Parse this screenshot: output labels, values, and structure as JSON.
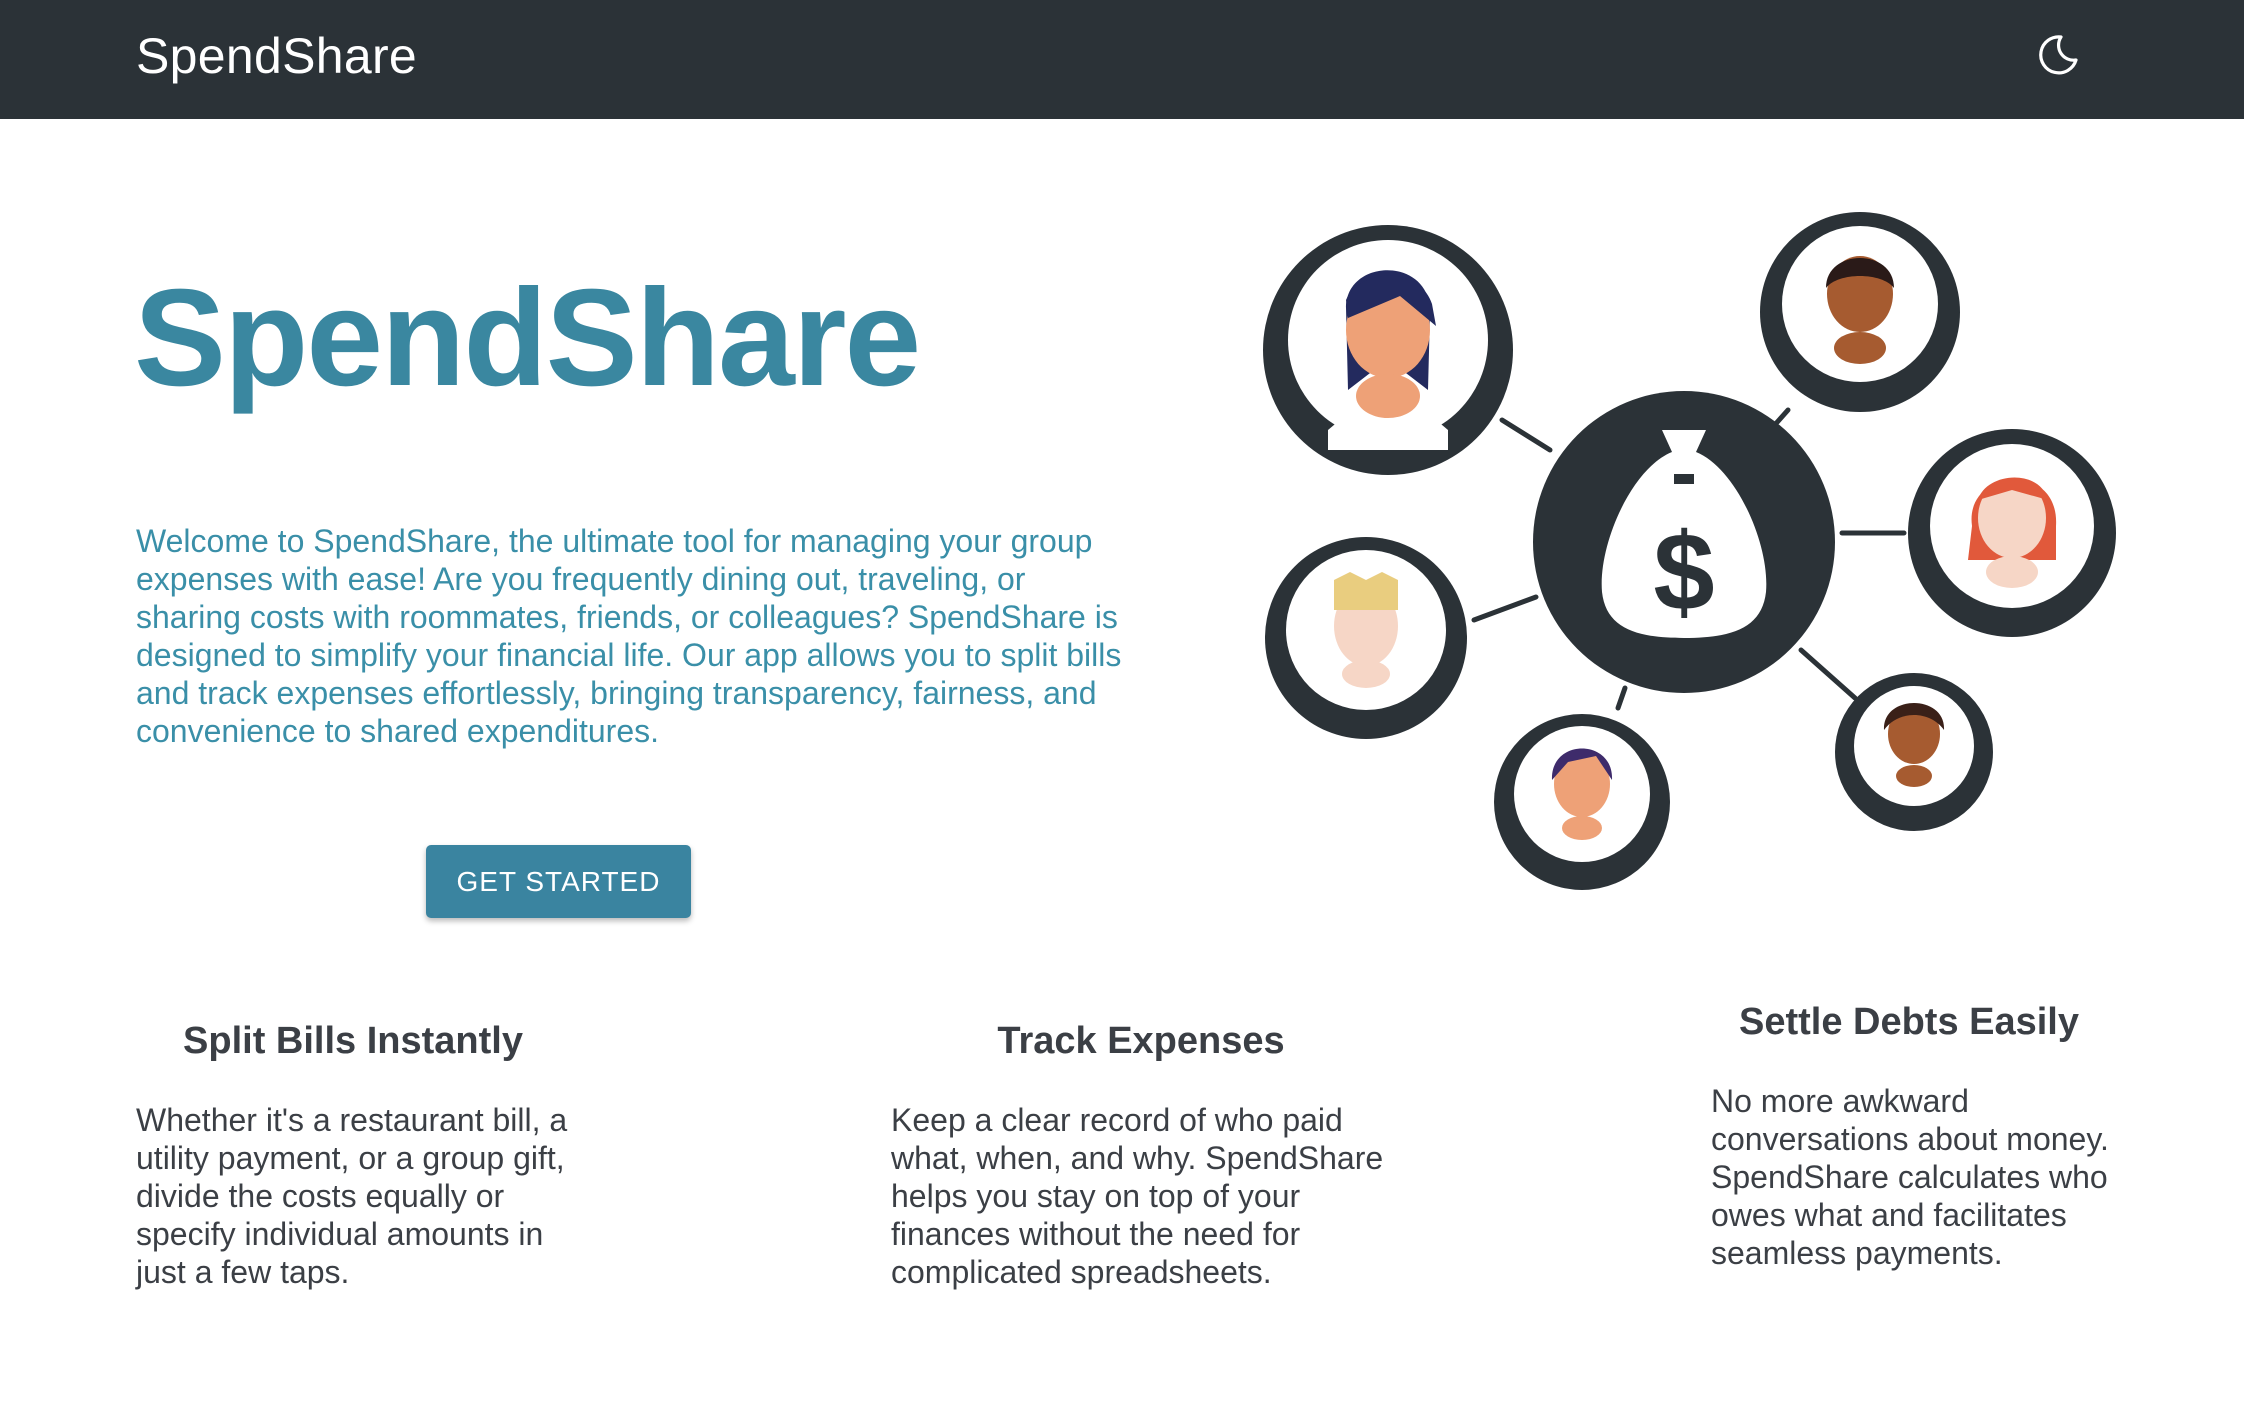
{
  "header": {
    "brand": "SpendShare",
    "theme_toggle_icon": "moon-icon"
  },
  "hero": {
    "title": "SpendShare",
    "description": "Welcome to SpendShare, the ultimate tool for managing your group expenses with ease! Are you frequently dining out, traveling, or sharing costs with roommates, friends, or colleagues? SpendShare is designed to simplify your financial life. Our app allows you to split bills and track expenses effortlessly, bringing transparency, fairness, and convenience to shared expenditures.",
    "cta_label": "GET STARTED",
    "illustration_icon": "money-bag-network-icon"
  },
  "features": [
    {
      "title": "Split Bills Instantly",
      "text": "Whether it's a restaurant bill, a utility payment, or a group gift, divide the costs equally or specify individual amounts in just a few taps."
    },
    {
      "title": "Track Expenses",
      "text": "Keep a clear record of who paid what, when, and why. SpendShare helps you stay on top of your finances without the need for complicated spreadsheets."
    },
    {
      "title": "Settle Debts Easily",
      "text": "No more awkward conversations about money. SpendShare calculates who owes what and facilitates seamless payments."
    }
  ],
  "colors": {
    "navbar": "#2b3237",
    "accent": "#3a87a0",
    "text_dark": "#3b3f45"
  }
}
